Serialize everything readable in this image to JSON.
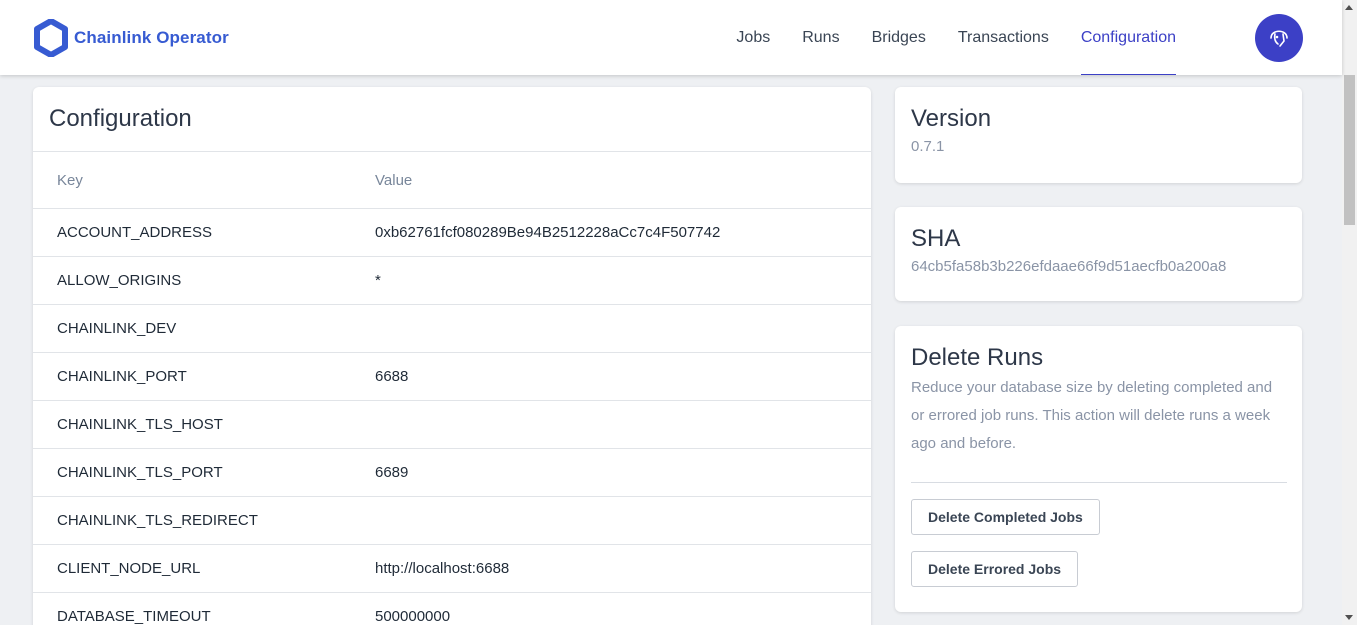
{
  "app": {
    "brand": "Chainlink Operator",
    "brand_color": "#375bd2",
    "accent_color": "#3c40c6"
  },
  "nav": {
    "items": [
      {
        "label": "Jobs"
      },
      {
        "label": "Runs"
      },
      {
        "label": "Bridges"
      },
      {
        "label": "Transactions"
      },
      {
        "label": "Configuration",
        "active": true
      }
    ],
    "avatar_icon": "operator-avatar-icon"
  },
  "config": {
    "title": "Configuration",
    "headers": {
      "key": "Key",
      "value": "Value"
    },
    "rows": [
      {
        "key": "ACCOUNT_ADDRESS",
        "value": "0xb62761fcf080289Be94B2512228aCc7c4F507742"
      },
      {
        "key": "ALLOW_ORIGINS",
        "value": "*"
      },
      {
        "key": "CHAINLINK_DEV",
        "value": ""
      },
      {
        "key": "CHAINLINK_PORT",
        "value": "6688"
      },
      {
        "key": "CHAINLINK_TLS_HOST",
        "value": ""
      },
      {
        "key": "CHAINLINK_TLS_PORT",
        "value": "6689"
      },
      {
        "key": "CHAINLINK_TLS_REDIRECT",
        "value": ""
      },
      {
        "key": "CLIENT_NODE_URL",
        "value": "http://localhost:6688"
      },
      {
        "key": "DATABASE_TIMEOUT",
        "value": "500000000"
      }
    ]
  },
  "version": {
    "title": "Version",
    "value": "0.7.1"
  },
  "sha": {
    "title": "SHA",
    "value": "64cb5fa58b3b226efdaae66f9d51aecfb0a200a8"
  },
  "delete_runs": {
    "title": "Delete Runs",
    "description": "Reduce your database size by deleting completed and or errored job runs. This action will delete runs a week ago and before.",
    "completed_button": "Delete Completed Jobs",
    "errored_button": "Delete Errored Jobs"
  }
}
